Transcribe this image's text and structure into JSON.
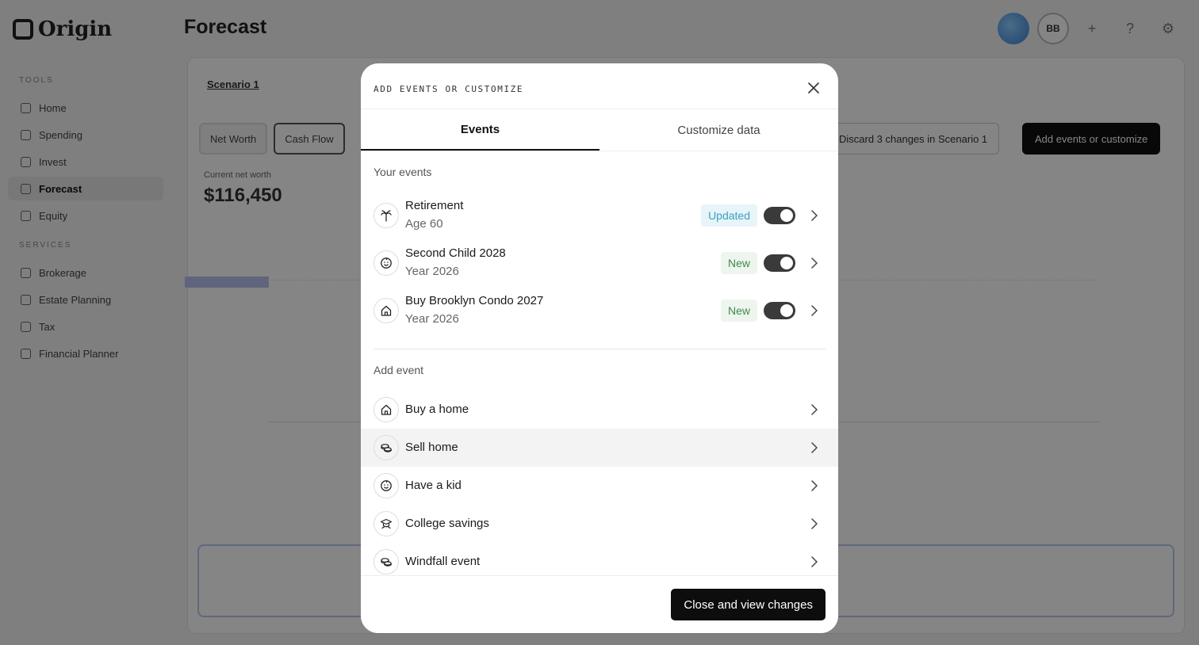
{
  "background": {
    "logo": "Origin",
    "page_title": "Forecast",
    "nav_section_1": "TOOLS",
    "nav_items": [
      "Home",
      "Spending",
      "Invest",
      "Forecast",
      "Equity"
    ],
    "nav_section_2": "SERVICES",
    "service_items": [
      "Brokerage",
      "Estate Planning",
      "Tax",
      "Financial Planner"
    ],
    "user_initials": "BB",
    "scenario": "Scenario 1",
    "tabs": [
      "Net Worth",
      "Cash Flow"
    ],
    "discard_label": "Discard 3 changes in Scenario 1",
    "add_label": "Add events or customize",
    "net_worth_label": "Current net worth",
    "net_worth_value": "$116,450"
  },
  "modal": {
    "title": "ADD EVENTS OR CUSTOMIZE",
    "tabs": [
      {
        "label": "Events",
        "active": true
      },
      {
        "label": "Customize data",
        "active": false
      }
    ],
    "your_events_label": "Your events",
    "your_events": [
      {
        "name": "Retirement",
        "sub": "Age 60",
        "badge": "Updated",
        "badge_type": "updated",
        "enabled": true,
        "icon": "palm-tree-icon"
      },
      {
        "name": "Second Child 2028",
        "sub": "Year 2026",
        "badge": "New",
        "badge_type": "new",
        "enabled": true,
        "icon": "baby-icon"
      },
      {
        "name": "Buy Brooklyn Condo 2027",
        "sub": "Year 2026",
        "badge": "New",
        "badge_type": "new",
        "enabled": true,
        "icon": "home-icon"
      }
    ],
    "add_event_label": "Add event",
    "add_events": [
      {
        "name": "Buy a home",
        "icon": "home-icon"
      },
      {
        "name": "Sell home",
        "icon": "coins-icon"
      },
      {
        "name": "Have a kid",
        "icon": "baby-icon"
      },
      {
        "name": "College savings",
        "icon": "graduation-cap-icon"
      },
      {
        "name": "Windfall event",
        "icon": "coins-icon"
      }
    ],
    "primary_button": "Close and view changes"
  }
}
